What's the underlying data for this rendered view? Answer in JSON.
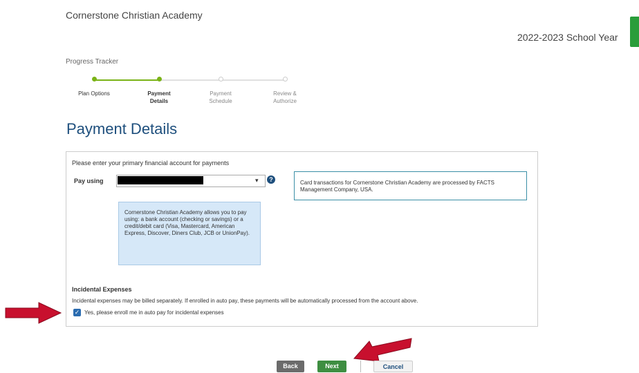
{
  "header": {
    "school_name": "Cornerstone Christian Academy",
    "school_year": "2022-2023 School Year"
  },
  "progress": {
    "title": "Progress Tracker",
    "steps": [
      {
        "label": "Plan Options",
        "state": "complete"
      },
      {
        "label": "Payment\nDetails",
        "state": "current"
      },
      {
        "label": "Payment\nSchedule",
        "state": "upcoming"
      },
      {
        "label": "Review &\nAuthorize",
        "state": "upcoming"
      }
    ]
  },
  "page_title": "Payment Details",
  "form": {
    "instruction": "Please enter your primary financial account for payments",
    "pay_using_label": "Pay using",
    "card_note": "Card transactions for Cornerstone Christian Academy are processed by FACTS Management Company, USA.",
    "methods_info": "Cornerstone Christian Academy allows you to pay using: a bank account (checking or savings) or a credit/debit card (Visa, Mastercard, American Express, Discover, Diners Club, JCB or UnionPay).",
    "incidental_heading": "Incidental Expenses",
    "incidental_desc": "Incidental expenses may be billed separately. If enrolled in auto pay, these payments will be automatically processed from the account above.",
    "autopay_label": "Yes, please enroll me in auto pay for incidental expenses",
    "autopay_checked": true
  },
  "buttons": {
    "back": "Back",
    "next": "Next",
    "cancel": "Cancel"
  },
  "colors": {
    "accent_green": "#7ab317",
    "title_blue": "#1e4f7d",
    "arrow_red": "#c8102e"
  }
}
